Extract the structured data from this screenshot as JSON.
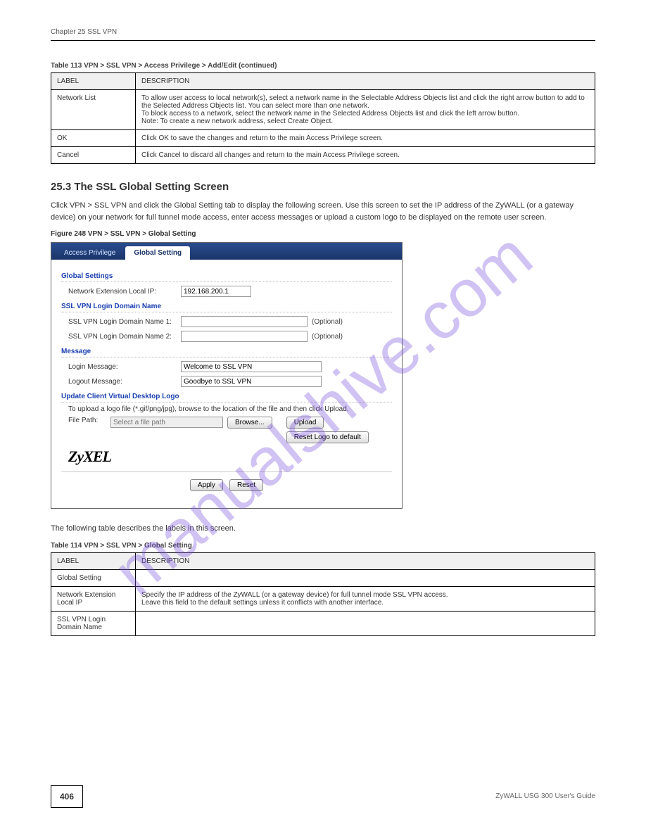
{
  "chapter_head": "Chapter 25 SSL VPN",
  "table113": {
    "caption": "Table 113   VPN > SSL VPN > Access Privilege > Add/Edit (continued)",
    "head_label": "LABEL",
    "head_desc": "DESCRIPTION",
    "rows": [
      {
        "label": "Network List",
        "desc": "To allow user access to local network(s), select a network name in the Selectable Address Objects list and click the right arrow button to add to the Selected Address Objects list. You can select more than one network.\nTo block access to a network, select the network name in the Selected Address Objects list and click the left arrow button.\nNote: To create a new network address, select Create Object. "
      },
      {
        "label": "OK",
        "desc": "Click OK to save the changes and return to the main Access Privilege screen. "
      },
      {
        "label": "Cancel",
        "desc": "Click Cancel to discard all changes and return to the main Access Privilege screen. "
      }
    ]
  },
  "section_title": "25.3  The SSL Global Setting Screen",
  "body1": "Click VPN > SSL VPN and click the Global Setting tab to display the following screen. Use this screen to set the IP address of the ZyWALL (or a gateway device) on your network for full tunnel mode access, enter access messages or upload a custom logo to be displayed on the remote user screen. ",
  "fig_caption": "Figure 248   VPN > SSL VPN > Global Setting",
  "screenshot": {
    "tab_inactive": "Access Privilege",
    "tab_active": "Global Setting",
    "h_global": "Global Settings",
    "lbl_netext": "Network Extension Local IP:",
    "val_netext": "192.168.200.1",
    "h_domain": "SSL VPN Login Domain Name",
    "lbl_dom1": "SSL VPN Login Domain Name 1:",
    "val_dom1": "",
    "lbl_dom2": "SSL VPN Login Domain Name 2:",
    "val_dom2": "",
    "optional": "(Optional)",
    "h_msg": "Message",
    "lbl_login": "Login Message:",
    "val_login": "Welcome to SSL VPN",
    "lbl_logout": "Logout Message:",
    "val_logout": "Goodbye to SSL VPN",
    "h_logo": "Update Client Virtual Desktop Logo",
    "hint": "To upload a logo file (*.gif/png/jpg), browse to the location of the file and then click Upload.",
    "lbl_filepath": "File Path:",
    "ph_filepath": "Select a file path",
    "btn_browse": "Browse...",
    "btn_upload": "Upload",
    "btn_reset_logo": "Reset Logo to default",
    "logo_text": "ZyXEL",
    "btn_apply": "Apply",
    "btn_reset": "Reset"
  },
  "body2": "The following table describes the labels in this screen.",
  "table114": {
    "caption": "Table 114    VPN > SSL VPN > Global Setting",
    "head_label": "LABEL",
    "head_desc": "DESCRIPTION",
    "rows": [
      {
        "label": "Global Setting ",
        "desc": ""
      },
      {
        "label": "Network Extension Local IP",
        "desc": "Specify the IP address of the ZyWALL (or a gateway device) for full tunnel mode SSL VPN access. \nLeave this field to the default settings unless it conflicts with another interface. "
      },
      {
        "label": "SSL VPN Login Domain Name",
        "desc": ""
      }
    ]
  },
  "footer_page": "406",
  "footer_guide": "ZyWALL USG 300 User's Guide",
  "watermark": "manualshive.com"
}
